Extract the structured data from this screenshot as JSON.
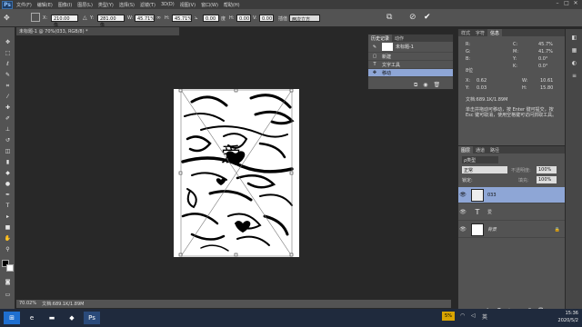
{
  "menubar": {
    "app": "Ps",
    "items": [
      "文件(F)",
      "编辑(E)",
      "图像(I)",
      "图层(L)",
      "类型(Y)",
      "选择(S)",
      "滤镜(T)",
      "3D(D)",
      "视图(V)",
      "窗口(W)",
      "帮助(H)"
    ]
  },
  "options": {
    "x_label": "X:",
    "x_value": "210.00 像",
    "y_label": "Y:",
    "y_value": "281.00 像",
    "w_label": "W:",
    "w_value": "45.71%",
    "h_label": "H:",
    "h_value": "45.71%",
    "rot_label": "0.00",
    "rot_unit": "度",
    "h2_label": "H:",
    "h2_value": "0.00",
    "v_label": "V:",
    "v_value": "0.00",
    "interp": "插值",
    "interp_value": "两次立方"
  },
  "doc": {
    "tab": "未标题-1 @ 70%(033, RGB/8) *",
    "zoom": "70.02%",
    "doc_size": "文档:689.1K/1.89M"
  },
  "history": {
    "tabs": [
      "历史记录",
      "动作"
    ],
    "snapshot": "未标题-1",
    "items": [
      {
        "label": "新建",
        "icon": "doc-icon"
      },
      {
        "label": "文字工具",
        "icon": "type-icon"
      },
      {
        "label": "移动",
        "icon": "move-icon"
      }
    ]
  },
  "props": {
    "tabs": [
      "样式",
      "字符",
      "信息"
    ],
    "r": "R:",
    "g": "G:",
    "b": "B:",
    "c_val": "45.7%",
    "m_val": "41.7%",
    "y_val": "0.0°",
    "k_val": "0.0°",
    "bits": "8位",
    "x": "X:",
    "x_val": "0.62",
    "y": "Y:",
    "y_val2": "0.03",
    "w": "W:",
    "w_val": "10.61",
    "h": "H:",
    "h_val": "15.80",
    "doc_size": "文档:689.1K/1.89M",
    "hint": "单击并拖动可移动，按 Enter 键可提交，按 Esc 键可取消，使用空格键可访问抓取工具。"
  },
  "layers": {
    "tabs": [
      "图层",
      "通道",
      "路径"
    ],
    "kind": "ρ类型",
    "blend": "正常",
    "opacity_label": "不透明度:",
    "opacity": "100%",
    "lock": "锁定:",
    "fill_label": "填充:",
    "fill": "100%",
    "items": [
      {
        "name": "033",
        "type": "image",
        "selected": true
      },
      {
        "name": "爱",
        "type": "text",
        "selected": false
      },
      {
        "name": "背景",
        "type": "bg",
        "selected": false
      }
    ]
  },
  "taskbar": {
    "time": "15:36",
    "date": "2020/5/2",
    "ime": "英",
    "battery": "5%"
  }
}
